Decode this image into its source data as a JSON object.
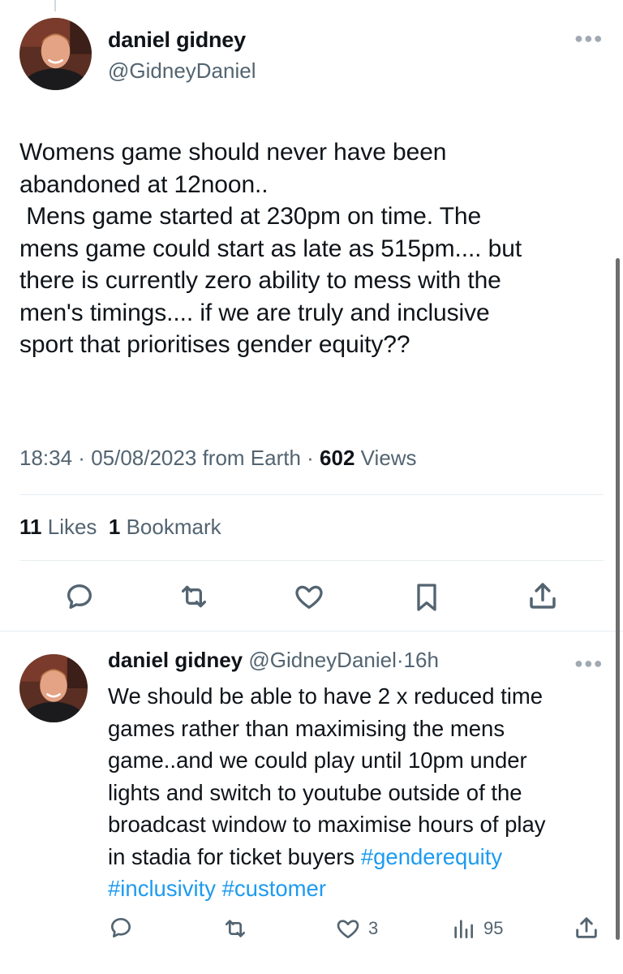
{
  "main_tweet": {
    "author_name": "daniel gidney",
    "author_handle": "@GidneyDaniel",
    "text_lines": [
      "Womens game should never have been",
      "abandoned at 12noon..",
      " Mens game started at 230pm on time. The",
      "mens game could start as late as 515pm.... but",
      "there is currently zero ability to mess with the",
      "men's timings.... if we are truly and inclusive",
      "sport that prioritises gender equity??"
    ],
    "time": "18:34",
    "date": "05/08/2023",
    "source": "from Earth",
    "views_count": "602",
    "views_label": "Views",
    "likes_count": "11",
    "likes_label": "Likes",
    "bookmarks_count": "1",
    "bookmarks_label": "Bookmark"
  },
  "reply": {
    "author_name": "daniel gidney",
    "author_handle": "@GidneyDaniel",
    "dot": "·",
    "time": "16h",
    "text_lines": [
      "We should be able to have 2 x reduced time",
      "games rather than maximising the mens",
      "game..and we could play until 10pm under",
      "lights and switch to youtube outside of the",
      "broadcast window to maximise hours of play"
    ],
    "line6_text": "in stadia for ticket buyers ",
    "hashtags": [
      "#genderequity",
      "#inclusivity",
      "#customer"
    ],
    "like_count": "3",
    "views_count": "95"
  },
  "separator": " · ",
  "icons": [
    "more-icon",
    "reply-icon",
    "retweet-icon",
    "like-icon",
    "bookmark-icon",
    "share-icon",
    "views-icon"
  ],
  "colors": {
    "link": "#1d9bf0",
    "muted": "#536471",
    "text": "#0f1419"
  }
}
